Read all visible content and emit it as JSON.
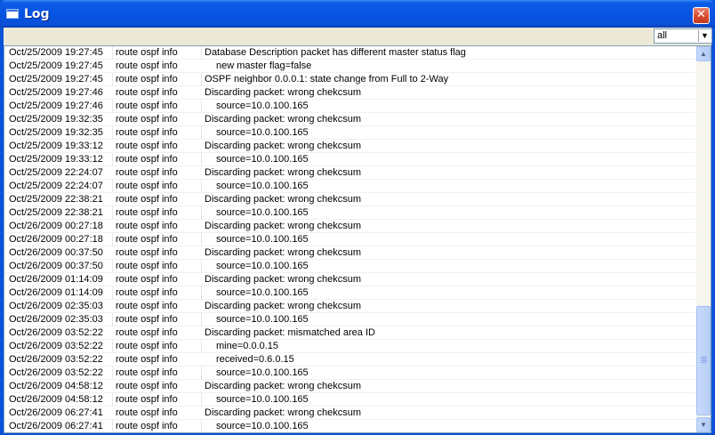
{
  "window": {
    "title": "Log",
    "close_label": "✕"
  },
  "filter": {
    "value": "all"
  },
  "rows": [
    {
      "time": "Oct/25/2009 19:27:45",
      "topics": "route ospf info",
      "message": "Database Description packet has different master status flag",
      "indent": false
    },
    {
      "time": "Oct/25/2009 19:27:45",
      "topics": "route ospf info",
      "message": "new master flag=false",
      "indent": true
    },
    {
      "time": "Oct/25/2009 19:27:45",
      "topics": "route ospf info",
      "message": "OSPF neighbor 0.0.0.1: state change from Full to 2-Way",
      "indent": false
    },
    {
      "time": "Oct/25/2009 19:27:46",
      "topics": "route ospf info",
      "message": "Discarding packet: wrong chekcsum",
      "indent": false
    },
    {
      "time": "Oct/25/2009 19:27:46",
      "topics": "route ospf info",
      "message": "source=10.0.100.165",
      "indent": true
    },
    {
      "time": "Oct/25/2009 19:32:35",
      "topics": "route ospf info",
      "message": "Discarding packet: wrong chekcsum",
      "indent": false
    },
    {
      "time": "Oct/25/2009 19:32:35",
      "topics": "route ospf info",
      "message": "source=10.0.100.165",
      "indent": true
    },
    {
      "time": "Oct/25/2009 19:33:12",
      "topics": "route ospf info",
      "message": "Discarding packet: wrong chekcsum",
      "indent": false
    },
    {
      "time": "Oct/25/2009 19:33:12",
      "topics": "route ospf info",
      "message": "source=10.0.100.165",
      "indent": true
    },
    {
      "time": "Oct/25/2009 22:24:07",
      "topics": "route ospf info",
      "message": "Discarding packet: wrong chekcsum",
      "indent": false
    },
    {
      "time": "Oct/25/2009 22:24:07",
      "topics": "route ospf info",
      "message": "source=10.0.100.165",
      "indent": true
    },
    {
      "time": "Oct/25/2009 22:38:21",
      "topics": "route ospf info",
      "message": "Discarding packet: wrong chekcsum",
      "indent": false
    },
    {
      "time": "Oct/25/2009 22:38:21",
      "topics": "route ospf info",
      "message": "source=10.0.100.165",
      "indent": true
    },
    {
      "time": "Oct/26/2009 00:27:18",
      "topics": "route ospf info",
      "message": "Discarding packet: wrong chekcsum",
      "indent": false
    },
    {
      "time": "Oct/26/2009 00:27:18",
      "topics": "route ospf info",
      "message": "source=10.0.100.165",
      "indent": true
    },
    {
      "time": "Oct/26/2009 00:37:50",
      "topics": "route ospf info",
      "message": "Discarding packet: wrong chekcsum",
      "indent": false
    },
    {
      "time": "Oct/26/2009 00:37:50",
      "topics": "route ospf info",
      "message": "source=10.0.100.165",
      "indent": true
    },
    {
      "time": "Oct/26/2009 01:14:09",
      "topics": "route ospf info",
      "message": "Discarding packet: wrong chekcsum",
      "indent": false
    },
    {
      "time": "Oct/26/2009 01:14:09",
      "topics": "route ospf info",
      "message": "source=10.0.100.165",
      "indent": true
    },
    {
      "time": "Oct/26/2009 02:35:03",
      "topics": "route ospf info",
      "message": "Discarding packet: wrong chekcsum",
      "indent": false
    },
    {
      "time": "Oct/26/2009 02:35:03",
      "topics": "route ospf info",
      "message": "source=10.0.100.165",
      "indent": true
    },
    {
      "time": "Oct/26/2009 03:52:22",
      "topics": "route ospf info",
      "message": "Discarding packet: mismatched area ID",
      "indent": false
    },
    {
      "time": "Oct/26/2009 03:52:22",
      "topics": "route ospf info",
      "message": "mine=0.0.0.15",
      "indent": true
    },
    {
      "time": "Oct/26/2009 03:52:22",
      "topics": "route ospf info",
      "message": "received=0.6.0.15",
      "indent": true
    },
    {
      "time": "Oct/26/2009 03:52:22",
      "topics": "route ospf info",
      "message": "source=10.0.100.165",
      "indent": true
    },
    {
      "time": "Oct/26/2009 04:58:12",
      "topics": "route ospf info",
      "message": "Discarding packet: wrong chekcsum",
      "indent": false
    },
    {
      "time": "Oct/26/2009 04:58:12",
      "topics": "route ospf info",
      "message": "source=10.0.100.165",
      "indent": true
    },
    {
      "time": "Oct/26/2009 06:27:41",
      "topics": "route ospf info",
      "message": "Discarding packet: wrong chekcsum",
      "indent": false
    },
    {
      "time": "Oct/26/2009 06:27:41",
      "topics": "route ospf info",
      "message": "source=10.0.100.165",
      "indent": true
    }
  ],
  "icons": {
    "window_icon": "window-icon",
    "close": "close-icon",
    "dropdown": "dropdown-arrow-icon",
    "scroll_up": "scroll-up-icon",
    "scroll_down": "scroll-down-icon"
  }
}
